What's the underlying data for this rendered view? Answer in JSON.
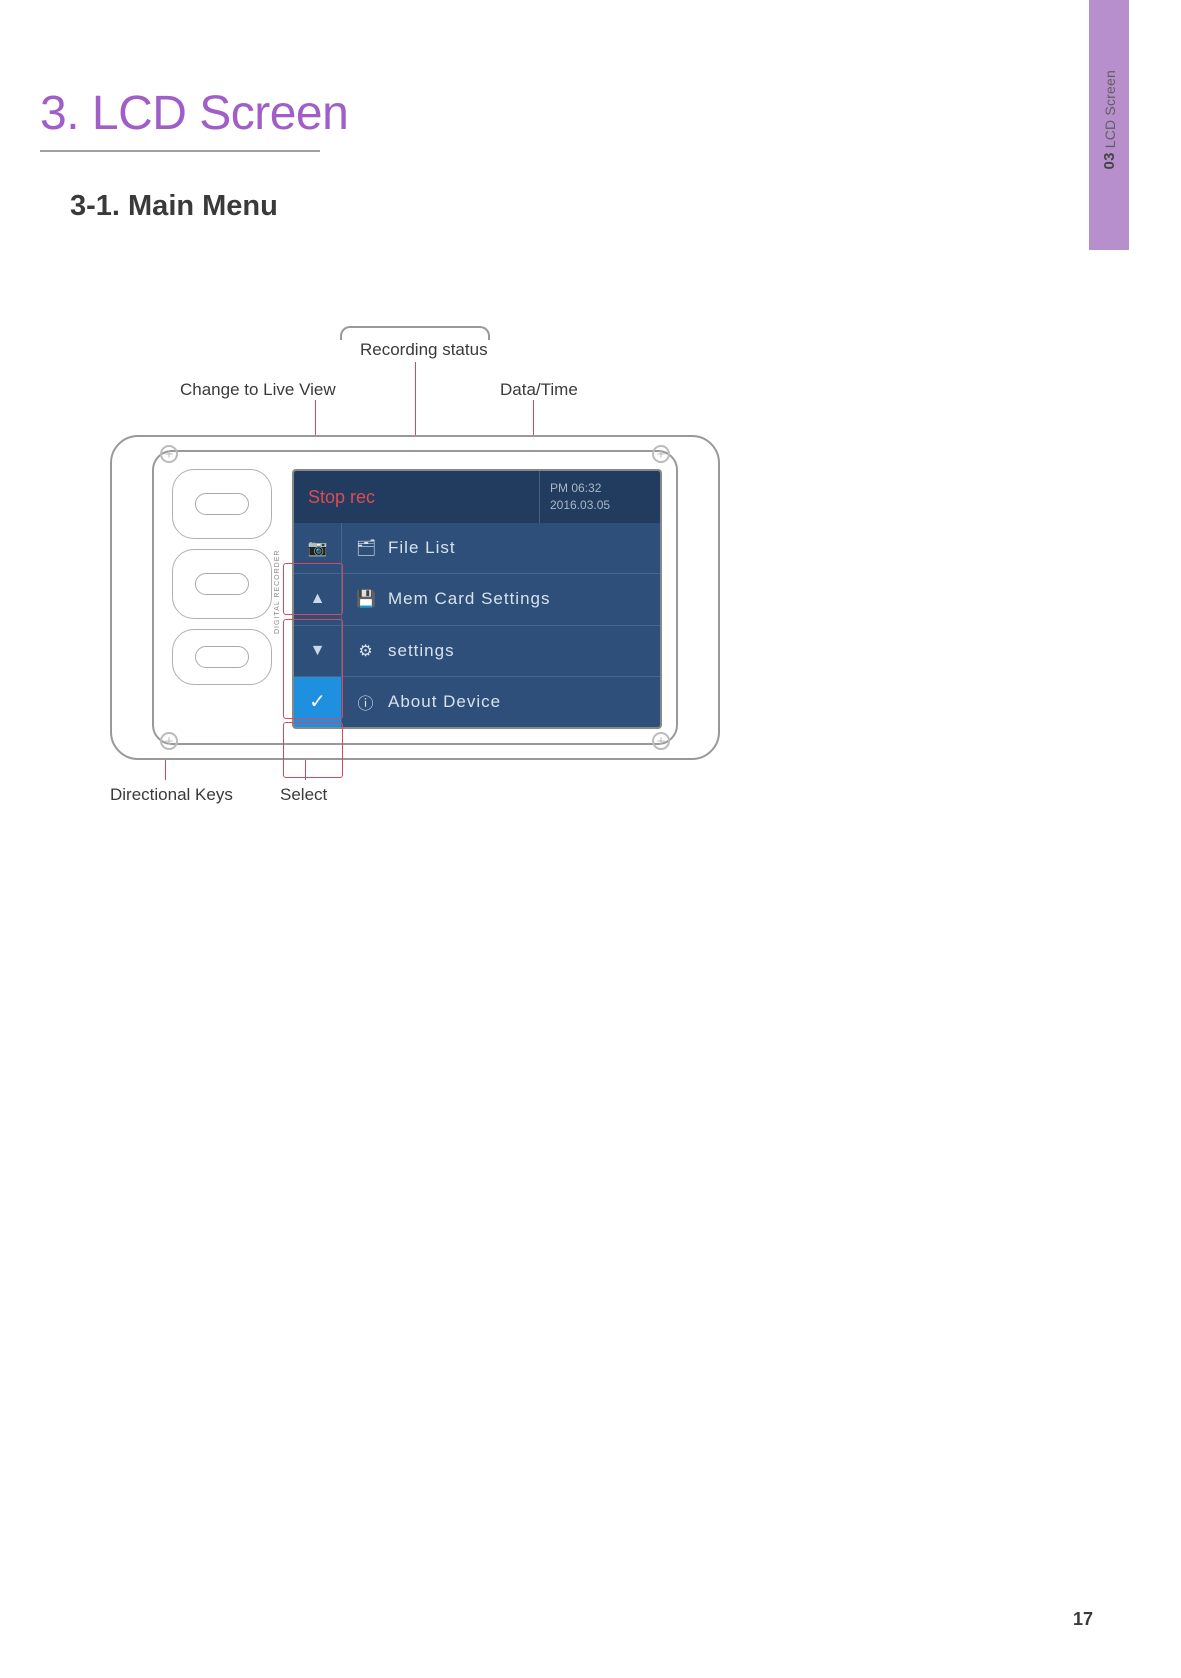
{
  "sideTab": {
    "num": "03",
    "label": "LCD Screen"
  },
  "chapterTitle": "3. LCD Screen",
  "sectionTitle": "3-1. Main Menu",
  "callouts": {
    "recordingStatus": "Recording status",
    "liveView": "Change to Live View",
    "dateTime": "Data/Time",
    "directionalKeys": "Directional Keys",
    "select": "Select"
  },
  "device": {
    "recorderLabel": "DIGITAL RECORDER",
    "lcd": {
      "header": {
        "status": "Stop rec",
        "time": "PM 06:32",
        "date": "2016.03.05"
      },
      "sideButtons": {
        "camera": "📷",
        "up": "▲",
        "down": "▼",
        "check": "✓"
      },
      "menu": [
        {
          "icon": "🗂",
          "label": "File List"
        },
        {
          "icon": "💾",
          "label": "Mem Card Settings"
        },
        {
          "icon": "⚙",
          "label": "settings"
        },
        {
          "icon": "ⓘ",
          "label": "About Device"
        }
      ]
    }
  },
  "pageNumber": "17"
}
